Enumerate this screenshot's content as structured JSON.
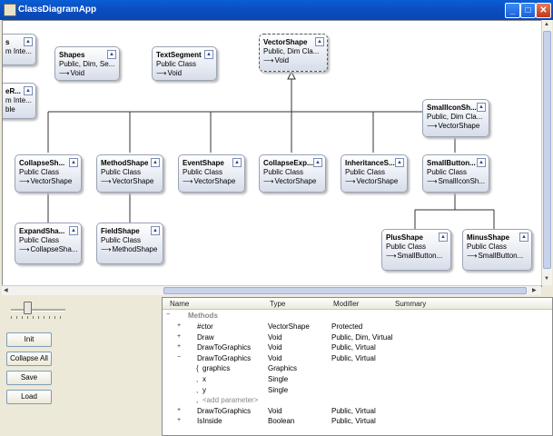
{
  "window": {
    "title": "ClassDiagramApp",
    "min": "_",
    "max": "□",
    "close": "✕"
  },
  "shapes": [
    {
      "id": "shapes",
      "name": "Shapes",
      "kind": "Public, Dim, Se...",
      "base": "Void"
    },
    {
      "id": "textsegment",
      "name": "TextSegment",
      "kind": "Public Class",
      "base": "Void"
    },
    {
      "id": "vectorshape",
      "name": "VectorShape",
      "kind": "Public, Dim Cla...",
      "base": "Void"
    },
    {
      "id": "smalliconshape",
      "name": "SmallIconSh...",
      "kind": "Public, Dim Cla...",
      "base": "VectorShape"
    },
    {
      "id": "collapseshape",
      "name": "CollapseSh...",
      "kind": "Public Class",
      "base": "VectorShape"
    },
    {
      "id": "methodshape",
      "name": "MethodShape",
      "kind": "Public Class",
      "base": "VectorShape"
    },
    {
      "id": "eventshape",
      "name": "EventShape",
      "kind": "Public Class",
      "base": "VectorShape"
    },
    {
      "id": "collapseexp",
      "name": "CollapseExp...",
      "kind": "Public Class",
      "base": "VectorShape"
    },
    {
      "id": "inheritance",
      "name": "InheritanceS...",
      "kind": "Public Class",
      "base": "VectorShape"
    },
    {
      "id": "smallbutton",
      "name": "SmallButton...",
      "kind": "Public Class",
      "base": "SmallIconSh..."
    },
    {
      "id": "expandshape",
      "name": "ExpandSha...",
      "kind": "Public Class",
      "base": "CollapseSha..."
    },
    {
      "id": "fieldshape",
      "name": "FieldShape",
      "kind": "Public Class",
      "base": "MethodShape"
    },
    {
      "id": "plusshape",
      "name": "PlusShape",
      "kind": "Public Class",
      "base": "SmallButton..."
    },
    {
      "id": "minusshape",
      "name": "MinusShape",
      "kind": "Public Class",
      "base": "SmallButton..."
    }
  ],
  "partial_shapes": [
    {
      "line1": "s",
      "line2": "m Inte..."
    },
    {
      "line1": "eR...",
      "line2": "m Inte...",
      "line3": "ble"
    }
  ],
  "buttons": {
    "init": "Init",
    "collapse_all": "Collapse All",
    "save": "Save",
    "load": "Load"
  },
  "zoom": {
    "level_fraction": 0.25
  },
  "grid": {
    "columns": [
      "Name",
      "Type",
      "Modifier",
      "Summary"
    ],
    "group": "Methods",
    "rows": [
      {
        "name": "#ctor",
        "type": "VectorShape",
        "modifier": "Protected",
        "exp": "+"
      },
      {
        "name": "Draw",
        "type": "Void",
        "modifier": "Public, Dim, Virtual",
        "exp": "+"
      },
      {
        "name": "DrawToGraphics",
        "type": "Void",
        "modifier": "Public, Virtual",
        "exp": "+"
      },
      {
        "name": "DrawToGraphics",
        "type": "Void",
        "modifier": "Public, Virtual",
        "exp": "−"
      },
      {
        "name": "graphics",
        "type": "Graphics",
        "modifier": "",
        "exp": "",
        "param": true
      },
      {
        "name": "x",
        "type": "Single",
        "modifier": "",
        "exp": "",
        "param": true
      },
      {
        "name": "y",
        "type": "Single",
        "modifier": "",
        "exp": "",
        "param": true
      },
      {
        "name": "<add parameter>",
        "type": "",
        "modifier": "",
        "exp": "",
        "param": true,
        "muted": true
      },
      {
        "name": "DrawToGraphics",
        "type": "Void",
        "modifier": "Public, Virtual",
        "exp": "+"
      },
      {
        "name": "IsInside",
        "type": "Boolean",
        "modifier": "Public, Virtual",
        "exp": "+"
      }
    ]
  },
  "icons": {
    "collapse": "chevron-up-icon",
    "inherit": "inherit-arrow-icon"
  }
}
